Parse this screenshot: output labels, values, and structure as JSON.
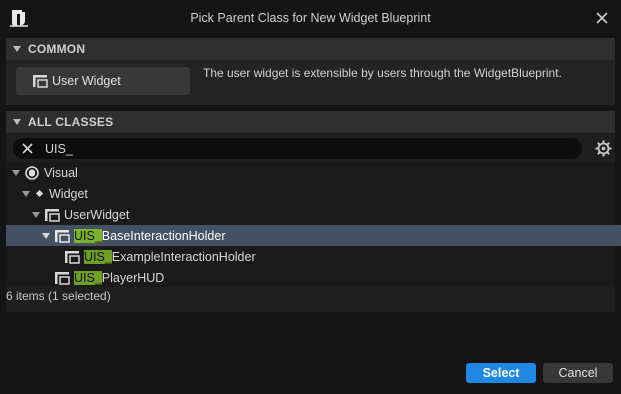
{
  "window": {
    "title": "Pick Parent Class for New Widget Blueprint"
  },
  "common": {
    "header": "COMMON",
    "user_widget_label": "User Widget",
    "description": "The user widget is extensible by users through the WidgetBlueprint."
  },
  "all_classes": {
    "header": "ALL CLASSES",
    "search_value": "UIS_",
    "tree": [
      {
        "label": "Visual",
        "highlight": "",
        "rest": "Visual",
        "icon": "visual-icon",
        "expanded": true
      },
      {
        "label": "Widget",
        "highlight": "",
        "rest": "Widget",
        "icon": "diamond-icon",
        "expanded": true
      },
      {
        "label": "UserWidget",
        "highlight": "",
        "rest": "UserWidget",
        "icon": "widget-icon",
        "expanded": true
      },
      {
        "label": "UIS_BaseInteractionHolder",
        "highlight": "UIS_",
        "rest": "BaseInteractionHolder",
        "icon": "widget-icon",
        "expanded": true,
        "selected": true
      },
      {
        "label": "UIS_ExampleInteractionHolder",
        "highlight": "UIS_",
        "rest": "ExampleInteractionHolder",
        "icon": "widget-icon",
        "expanded": false
      },
      {
        "label": "UIS_PlayerHUD",
        "highlight": "UIS_",
        "rest": "PlayerHUD",
        "icon": "widget-icon",
        "expanded": false
      }
    ],
    "item_count": "6 items (1 selected)"
  },
  "buttons": {
    "select": "Select",
    "cancel": "Cancel"
  },
  "colors": {
    "accent": "#1e88e5",
    "selection": "#435163",
    "search_highlight": "#6e9e22"
  }
}
